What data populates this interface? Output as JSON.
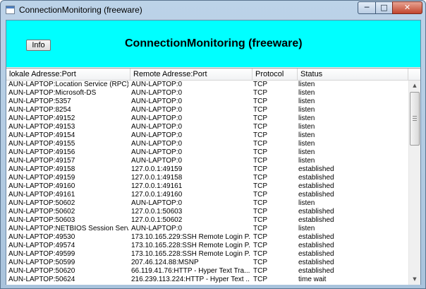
{
  "window": {
    "title": "ConnectionMonitoring (freeware)",
    "minimize_glyph": "─",
    "maximize_glyph": "□",
    "close_glyph": "✕"
  },
  "banner": {
    "info_label": "Info",
    "title": "ConnectionMonitoring (freeware)",
    "background": "#00ffff"
  },
  "table": {
    "columns": [
      "lokale Adresse:Port",
      "Remote Adresse:Port",
      "Protocol",
      "Status"
    ],
    "rows": [
      [
        "AUN-LAPTOP:Location Service (RPC) ...",
        "AUN-LAPTOP:0",
        "TCP",
        "listen"
      ],
      [
        "AUN-LAPTOP:Microsoft-DS",
        "AUN-LAPTOP:0",
        "TCP",
        "listen"
      ],
      [
        "AUN-LAPTOP:5357",
        "AUN-LAPTOP:0",
        "TCP",
        "listen"
      ],
      [
        "AUN-LAPTOP:8254",
        "AUN-LAPTOP:0",
        "TCP",
        "listen"
      ],
      [
        "AUN-LAPTOP:49152",
        "AUN-LAPTOP:0",
        "TCP",
        "listen"
      ],
      [
        "AUN-LAPTOP:49153",
        "AUN-LAPTOP:0",
        "TCP",
        "listen"
      ],
      [
        "AUN-LAPTOP:49154",
        "AUN-LAPTOP:0",
        "TCP",
        "listen"
      ],
      [
        "AUN-LAPTOP:49155",
        "AUN-LAPTOP:0",
        "TCP",
        "listen"
      ],
      [
        "AUN-LAPTOP:49156",
        "AUN-LAPTOP:0",
        "TCP",
        "listen"
      ],
      [
        "AUN-LAPTOP:49157",
        "AUN-LAPTOP:0",
        "TCP",
        "listen"
      ],
      [
        "AUN-LAPTOP:49158",
        "127.0.0.1:49159",
        "TCP",
        "established"
      ],
      [
        "AUN-LAPTOP:49159",
        "127.0.0.1:49158",
        "TCP",
        "established"
      ],
      [
        "AUN-LAPTOP:49160",
        "127.0.0.1:49161",
        "TCP",
        "established"
      ],
      [
        "AUN-LAPTOP:49161",
        "127.0.0.1:49160",
        "TCP",
        "established"
      ],
      [
        "AUN-LAPTOP:50602",
        "AUN-LAPTOP:0",
        "TCP",
        "listen"
      ],
      [
        "AUN-LAPTOP:50602",
        "127.0.0.1:50603",
        "TCP",
        "established"
      ],
      [
        "AUN-LAPTOP:50603",
        "127.0.0.1:50602",
        "TCP",
        "established"
      ],
      [
        "AUN-LAPTOP:NETBIOS Session Servi...",
        "AUN-LAPTOP:0",
        "TCP",
        "listen"
      ],
      [
        "AUN-LAPTOP:49530",
        "173.10.165.229:SSH Remote Login P...",
        "TCP",
        "established"
      ],
      [
        "AUN-LAPTOP:49574",
        "173.10.165.228:SSH Remote Login P...",
        "TCP",
        "established"
      ],
      [
        "AUN-LAPTOP:49599",
        "173.10.165.228:SSH Remote Login P...",
        "TCP",
        "established"
      ],
      [
        "AUN-LAPTOP:50599",
        "207.46.124.88:MSNP",
        "TCP",
        "established"
      ],
      [
        "AUN-LAPTOP:50620",
        "66.119.41.76:HTTP - Hyper Text Tra...",
        "TCP",
        "established"
      ],
      [
        "AUN-LAPTOP:50624",
        "216.239.113.224:HTTP - Hyper Text ...",
        "TCP",
        "time wait"
      ]
    ]
  },
  "scrollbar": {
    "up_glyph": "▲",
    "down_glyph": "▼"
  }
}
